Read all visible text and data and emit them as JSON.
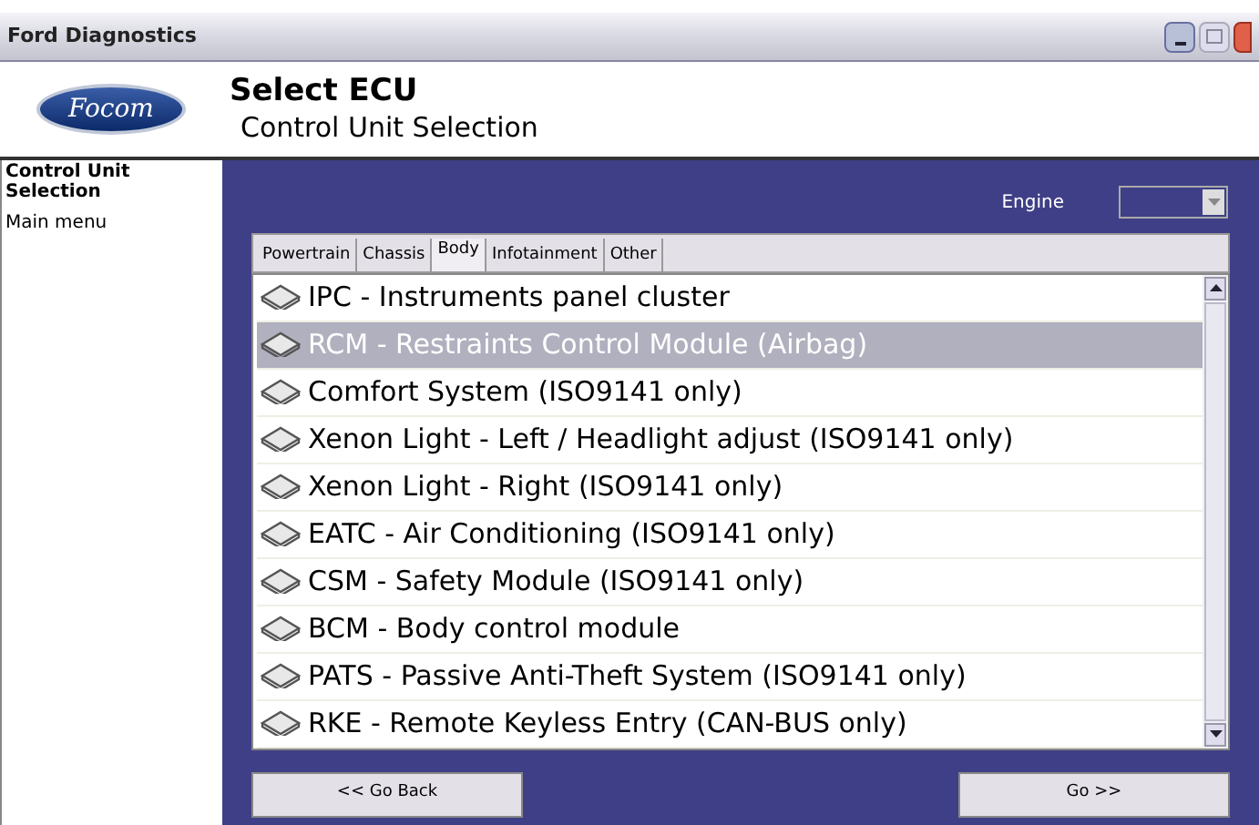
{
  "window": {
    "title": "Ford Diagnostics"
  },
  "header": {
    "logo": "Focom",
    "title": "Select ECU",
    "subtitle": "Control Unit Selection"
  },
  "sidebar": {
    "items": [
      {
        "label": "Control Unit Selection",
        "selected": true
      },
      {
        "label": "Main menu",
        "selected": false
      }
    ]
  },
  "engine": {
    "label": "Engine"
  },
  "tabs": [
    {
      "label": "Powertrain",
      "selected": false
    },
    {
      "label": "Chassis",
      "selected": false
    },
    {
      "label": "Body",
      "selected": true
    },
    {
      "label": "Infotainment",
      "selected": false
    },
    {
      "label": "Other",
      "selected": false
    }
  ],
  "ecus": [
    {
      "label": "IPC - Instruments panel cluster",
      "selected": false
    },
    {
      "label": "RCM - Restraints Control Module (Airbag)",
      "selected": true
    },
    {
      "label": "Comfort System (ISO9141 only)",
      "selected": false
    },
    {
      "label": "Xenon Light - Left / Headlight adjust (ISO9141 only)",
      "selected": false
    },
    {
      "label": "Xenon Light - Right (ISO9141 only)",
      "selected": false
    },
    {
      "label": "EATC - Air Conditioning (ISO9141 only)",
      "selected": false
    },
    {
      "label": "CSM - Safety Module (ISO9141 only)",
      "selected": false
    },
    {
      "label": "BCM - Body control module",
      "selected": false
    },
    {
      "label": "PATS - Passive Anti-Theft System (ISO9141 only)",
      "selected": false
    },
    {
      "label": "RKE - Remote Keyless Entry (CAN-BUS only)",
      "selected": false
    }
  ],
  "buttons": {
    "back": "<< Go Back",
    "go": "Go >>"
  }
}
